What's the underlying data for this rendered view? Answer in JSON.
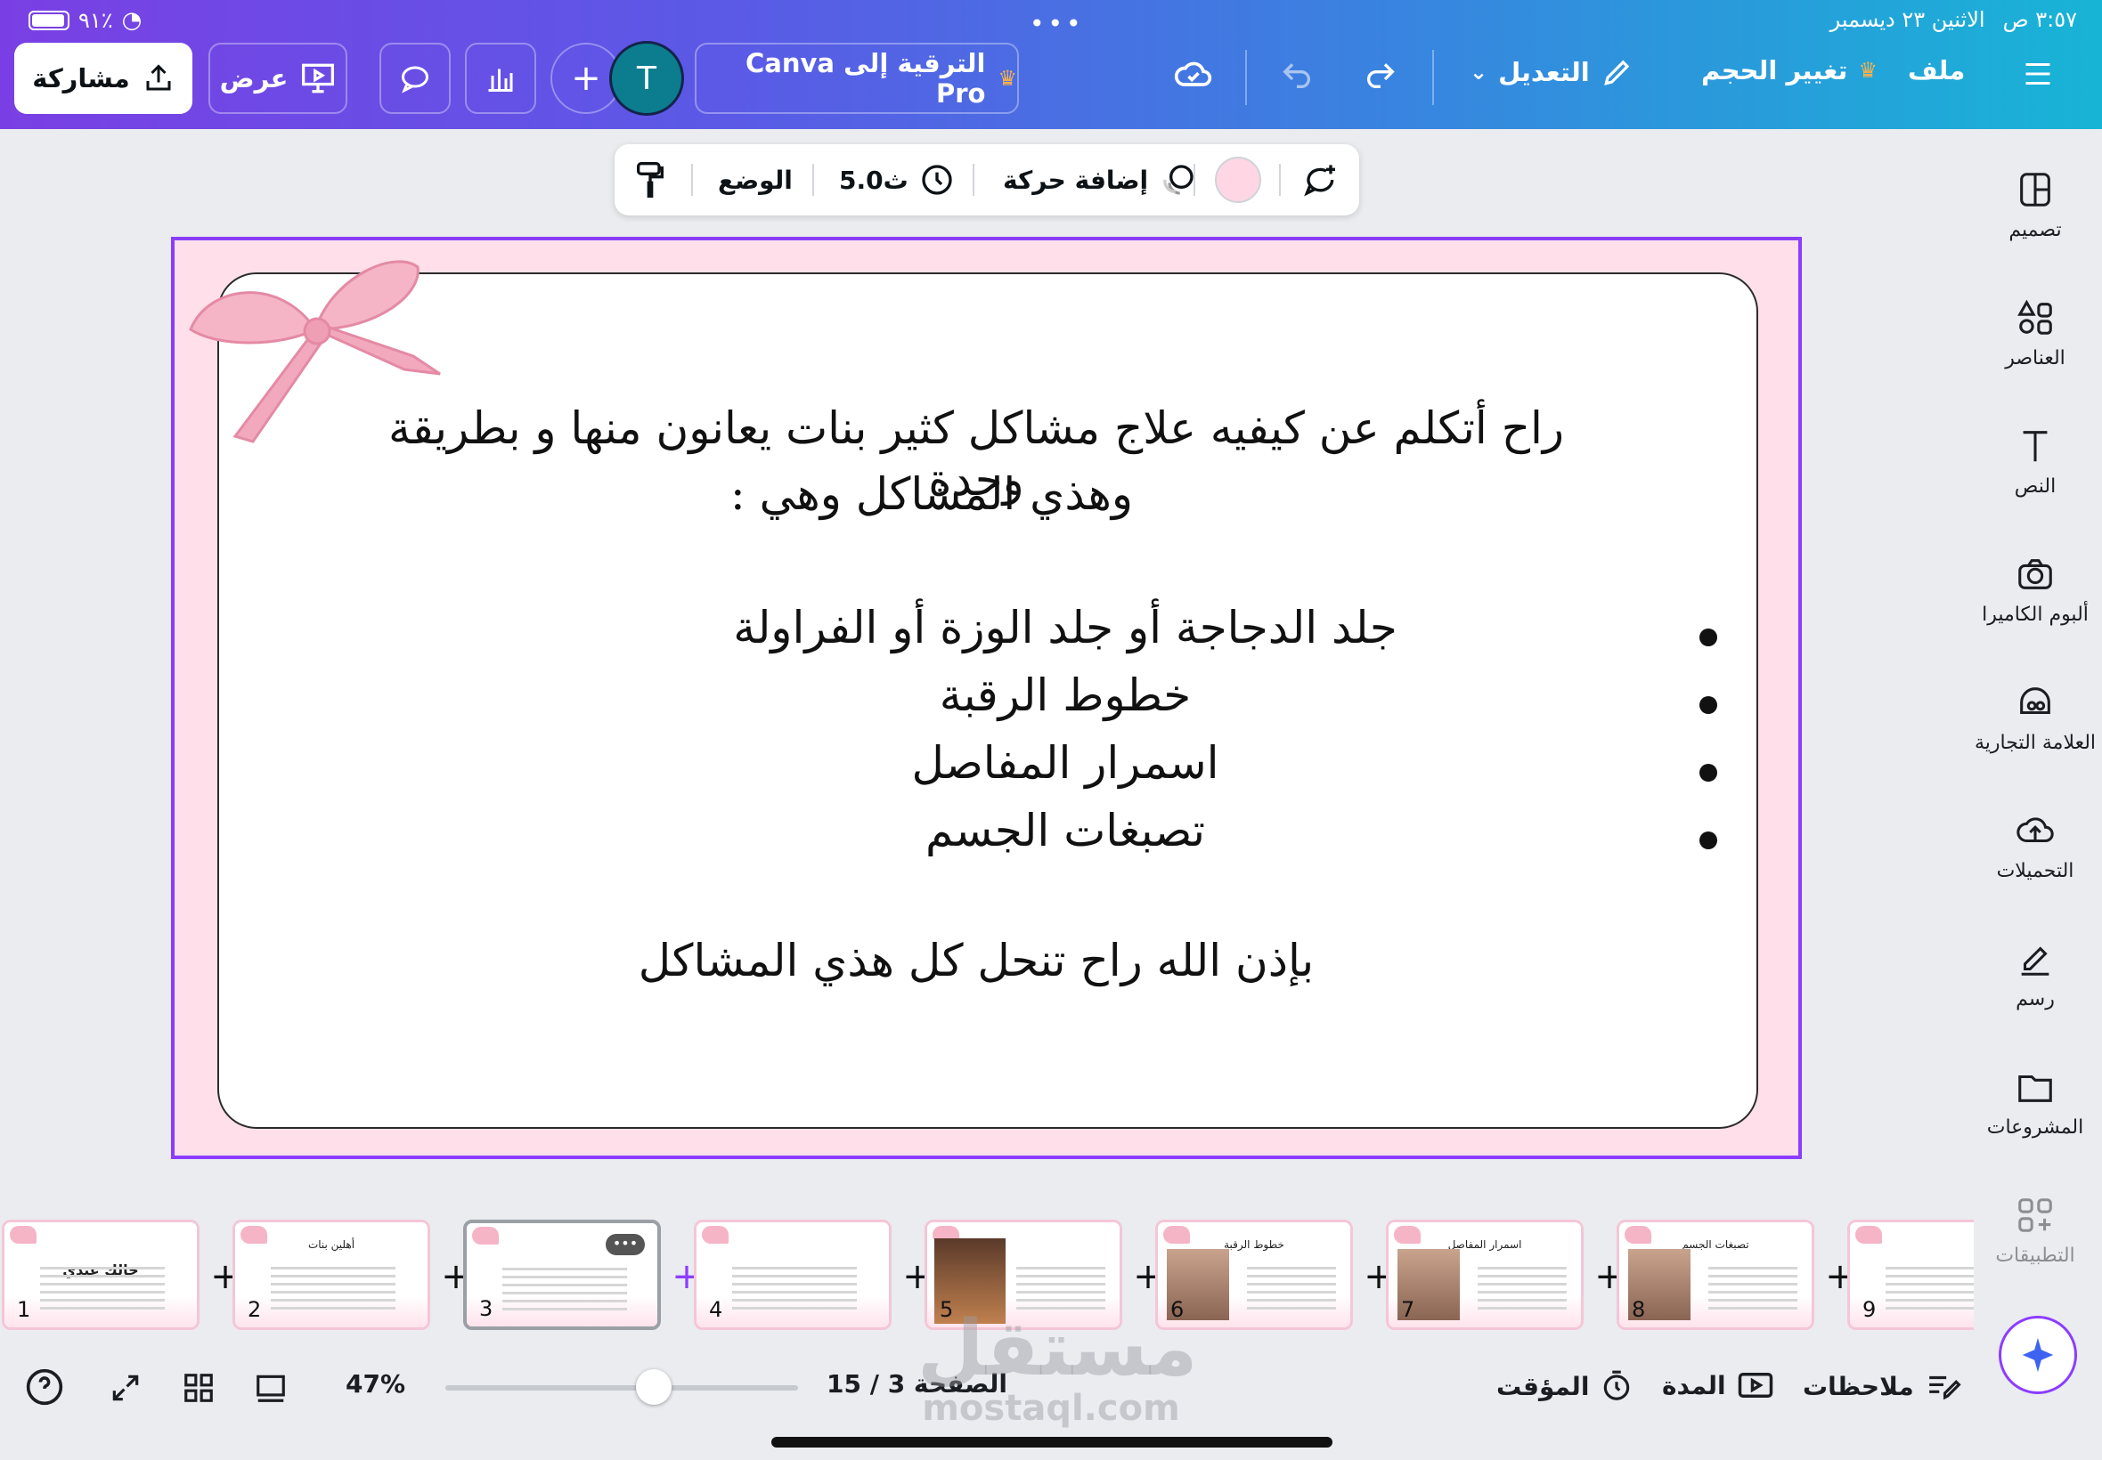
{
  "status_bar": {
    "time": "٣:٥٧ ص",
    "date": "الاثنين ٢٣ ديسمبر",
    "battery": "٩١٪"
  },
  "topbar": {
    "menu_icon": "hamburger-icon",
    "file": "ملف",
    "resize": "تغيير الحجم",
    "edit": "التعديل",
    "upgrade": "الترقية إلى Canva Pro",
    "avatar_letter": "T",
    "present": "عرض",
    "share": "مشاركة"
  },
  "float_toolbar": {
    "position": "الوضع",
    "duration": "5.0ث",
    "animate": "إضافة حركة",
    "color": "#ffd6e3"
  },
  "slide": {
    "intro_line1": "راح أتكلم عن كيفيه علاج مشاكل كثير بنات يعانون منها و بطريقة وحدة",
    "intro_line2": "وهذي المشاكل وهي :",
    "bullets": [
      "جلد الدجاجة أو جلد الوزة أو الفراولة",
      "خطوط الرقبة",
      "اسمرار المفاصل",
      "تصبغات الجسم"
    ],
    "closing": "بإذن الله راح تنحل كل هذي المشاكل"
  },
  "sidebar": {
    "items": [
      {
        "label": "تصميم",
        "icon": "design-icon"
      },
      {
        "label": "العناصر",
        "icon": "elements-icon"
      },
      {
        "label": "النص",
        "icon": "text-icon"
      },
      {
        "label": "ألبوم الكاميرا",
        "icon": "camera-icon"
      },
      {
        "label": "العلامة التجارية",
        "icon": "brand-icon"
      },
      {
        "label": "التحميلات",
        "icon": "upload-icon"
      },
      {
        "label": "رسم",
        "icon": "draw-icon"
      },
      {
        "label": "المشروعات",
        "icon": "folder-icon"
      },
      {
        "label": "التطبيقات",
        "icon": "apps-icon"
      }
    ]
  },
  "thumbnails": [
    {
      "num": "1",
      "title": "حالك عندي"
    },
    {
      "num": "2",
      "title": "أهلين بنات"
    },
    {
      "num": "3",
      "title": ""
    },
    {
      "num": "4",
      "title": ""
    },
    {
      "num": "5",
      "title": ""
    },
    {
      "num": "6",
      "title": "خطوط الرقبة"
    },
    {
      "num": "7",
      "title": "اسمرار المفاصل"
    },
    {
      "num": "8",
      "title": "تصبغات الجسم"
    },
    {
      "num": "9",
      "title": ""
    }
  ],
  "bottom_bar": {
    "zoom": "47%",
    "page": "الصفحة 3 / 15",
    "timer": "المؤقت",
    "duration": "المدة",
    "notes": "ملاحظات",
    "zoom_value_fraction": 0.59
  },
  "watermark": {
    "line1": "مستقل",
    "line2": "mostaql.com"
  }
}
